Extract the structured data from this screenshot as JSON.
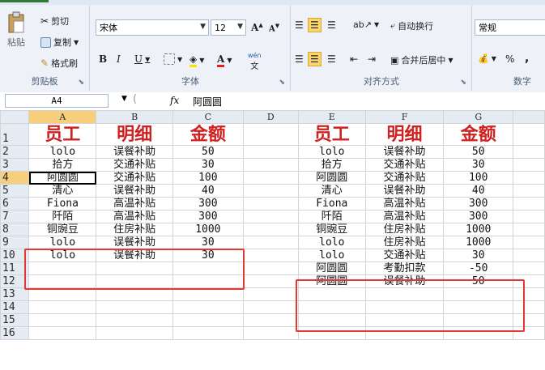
{
  "ribbon": {
    "clipboard": {
      "paste": "粘贴",
      "cut": "剪切",
      "copy": "复制",
      "format_painter": "格式刷",
      "label": "剪贴板"
    },
    "font": {
      "name": "宋体",
      "size": "12",
      "bold": "B",
      "italic": "I",
      "underline": "U",
      "wen": "wén",
      "label": "字体"
    },
    "alignment": {
      "wrap": "自动换行",
      "merge": "合并后居中",
      "label": "对齐方式"
    },
    "number": {
      "format": "常规",
      "percent": "%",
      "comma": ",",
      "label": "数字"
    }
  },
  "formula_bar": {
    "name_box": "A4",
    "fx": "fx",
    "value": "阿圆圆"
  },
  "columns": [
    "A",
    "B",
    "C",
    "D",
    "E",
    "F",
    "G"
  ],
  "rows": [
    "1",
    "2",
    "3",
    "4",
    "5",
    "6",
    "7",
    "8",
    "9",
    "10",
    "11",
    "12",
    "13",
    "14",
    "15",
    "16"
  ],
  "cells": [
    [
      "员工",
      "明细",
      "金额",
      "",
      "员工",
      "明细",
      "金额"
    ],
    [
      "lolo",
      "误餐补助",
      "50",
      "",
      "lolo",
      "误餐补助",
      "50"
    ],
    [
      "拾方",
      "交通补贴",
      "30",
      "",
      "拾方",
      "交通补贴",
      "30"
    ],
    [
      "阿圆圆",
      "交通补贴",
      "100",
      "",
      "阿圆圆",
      "交通补贴",
      "100"
    ],
    [
      "清心",
      "误餐补助",
      "40",
      "",
      "清心",
      "误餐补助",
      "40"
    ],
    [
      "Fiona",
      "高温补贴",
      "300",
      "",
      "Fiona",
      "高温补贴",
      "300"
    ],
    [
      "阡陌",
      "高温补贴",
      "300",
      "",
      "阡陌",
      "高温补贴",
      "300"
    ],
    [
      "铜豌豆",
      "住房补贴",
      "1000",
      "",
      "铜豌豆",
      "住房补贴",
      "1000"
    ],
    [
      "lolo",
      "误餐补助",
      "30",
      "",
      "lolo",
      "住房补贴",
      "1000"
    ],
    [
      "lolo",
      "误餐补助",
      "30",
      "",
      "lolo",
      "交通补贴",
      "30"
    ],
    [
      "",
      "",
      "",
      "",
      "阿圆圆",
      "考勤扣款",
      "-50"
    ],
    [
      "",
      "",
      "",
      "",
      "阿圆圆",
      "误餐补助",
      "50"
    ],
    [
      "",
      "",
      "",
      "",
      "",
      "",
      ""
    ],
    [
      "",
      "",
      "",
      "",
      "",
      "",
      ""
    ],
    [
      "",
      "",
      "",
      "",
      "",
      "",
      ""
    ],
    [
      "",
      "",
      "",
      "",
      "",
      "",
      ""
    ]
  ],
  "colors": {
    "header_red": "#d0201f",
    "annotation_red": "#e23a33",
    "selected_header": "#f7cf7c"
  }
}
